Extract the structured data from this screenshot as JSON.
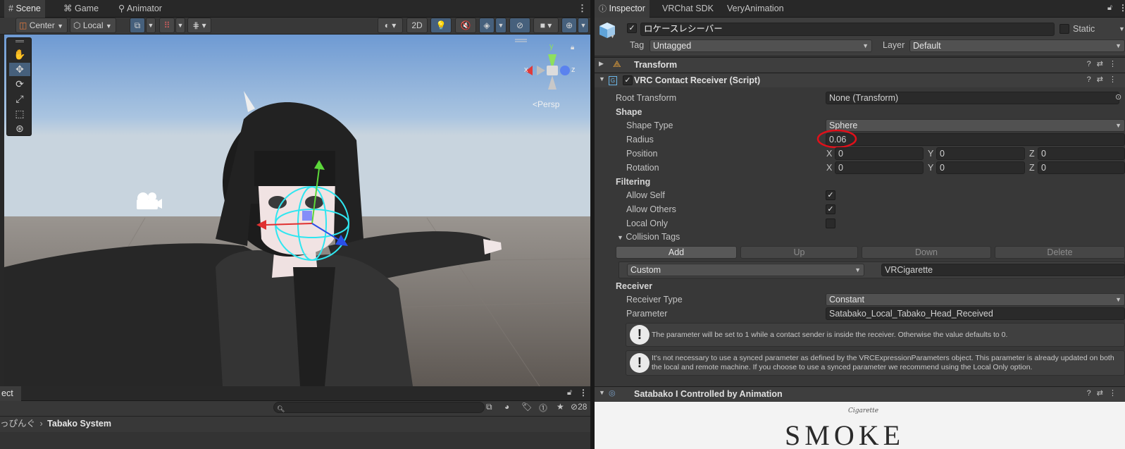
{
  "scene_panel": {
    "tabs": [
      {
        "icon": "hash-icon",
        "label": "Scene"
      },
      {
        "icon": "gamepad-icon",
        "label": "Game"
      },
      {
        "icon": "animator-icon",
        "label": "Animator"
      }
    ],
    "toolbar": {
      "pivot_mode": "Center",
      "pivot_rotation": "Local",
      "mode_2d": "2D"
    },
    "gizmo": {
      "y_axis": "y",
      "x_axis": "x",
      "z_axis": "z",
      "projection": "Persp"
    }
  },
  "project_panel": {
    "tab_label": "ect",
    "breadcrumb": [
      "っぴんぐ",
      "Tabako System"
    ],
    "hidden_count": "28"
  },
  "inspector": {
    "tabs": [
      {
        "label": "Inspector",
        "icon": "info-icon"
      },
      {
        "label": "VRChat SDK"
      },
      {
        "label": "VeryAnimation"
      }
    ],
    "object": {
      "name": "ロケースレシーバー",
      "static_label": "Static",
      "tag_label": "Tag",
      "tag_value": "Untagged",
      "layer_label": "Layer",
      "layer_value": "Default"
    },
    "components": {
      "transform": "Transform",
      "contact_receiver": "VRC Contact Receiver (Script)",
      "satabako": "Satabako I Controlled by Animation"
    },
    "fields": {
      "root_transform_label": "Root Transform",
      "root_transform_value": "None (Transform)",
      "shape_section": "Shape",
      "shape_type_label": "Shape Type",
      "shape_type_value": "Sphere",
      "radius_label": "Radius",
      "radius_value": "0.06",
      "position_label": "Position",
      "position": {
        "x": "0",
        "y": "0",
        "z": "0"
      },
      "rotation_label": "Rotation",
      "rotation": {
        "x": "0",
        "y": "0",
        "z": "0"
      },
      "axis_x": "X",
      "axis_y": "Y",
      "axis_z": "Z",
      "filtering_section": "Filtering",
      "allow_self_label": "Allow Self",
      "allow_self": true,
      "allow_others_label": "Allow Others",
      "allow_others": true,
      "local_only_label": "Local Only",
      "local_only": false,
      "collision_tags_label": "Collision Tags",
      "tag_buttons": [
        "Add",
        "Up",
        "Down",
        "Delete"
      ],
      "tag_type": "Custom",
      "tag_value": "VRCigarette",
      "receiver_section": "Receiver",
      "receiver_type_label": "Receiver Type",
      "receiver_type_value": "Constant",
      "parameter_label": "Parameter",
      "parameter_value": "Satabako_Local_Tabako_Head_Received"
    },
    "help": [
      "The parameter will be set to 1 while a contact sender is inside the receiver.  Otherwise the value defaults to 0.",
      "It's not necessary to use a synced parameter as defined by the VRCExpressionParameters object.  This parameter is already updated on both the local and remote machine.  If you choose to use a synced parameter we recommend using the Local Only option."
    ],
    "banner": {
      "signature": "Cigarette",
      "title": "SMOKE"
    }
  },
  "colors": {
    "panel": "#383838",
    "header": "#3e3e3e",
    "accent": "#46607c",
    "annotation": "#e0101a",
    "collider": "#2fe6f0"
  }
}
